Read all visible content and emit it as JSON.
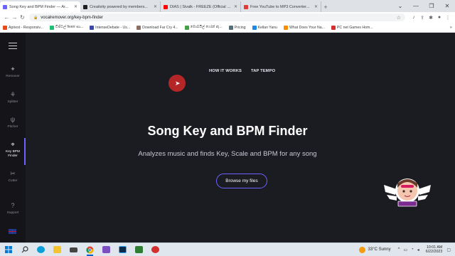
{
  "tabs": [
    {
      "title": "Song Key and BPM Finder — Ar...",
      "active": true,
      "icon": "vocalremover-favicon",
      "color": "#6c63ff"
    },
    {
      "title": "Creativity powered by members...",
      "active": false,
      "icon": "patreon-favicon",
      "color": "#1f1f1f"
    },
    {
      "title": "DIAS | Sivalk - FREEZE (Official Mu...",
      "active": false,
      "icon": "youtube-favicon",
      "color": "#ff0000"
    },
    {
      "title": "Free YouTube to MP3 Converter...",
      "active": false,
      "icon": "converter-favicon",
      "color": "#e53935"
    }
  ],
  "address": {
    "url": "vocalremover.org/key-bpm-finder"
  },
  "bookmarks": [
    {
      "label": "Apriest - Responsiv...",
      "color": "#e64a19"
    },
    {
      "label": "ඩිජිටල් fiverr සා...",
      "color": "#1dbf73"
    },
    {
      "label": "IntenseDebate - Us...",
      "color": "#3949ab"
    },
    {
      "label": "Download Far Cry 4...",
      "color": "#8d6e63"
    },
    {
      "label": "මොබයිල් ෆෝන් ඇ...",
      "color": "#43a047"
    },
    {
      "label": "Pricing",
      "color": "#546e7a"
    },
    {
      "label": "Kellan Yanu",
      "color": "#1e88e5"
    },
    {
      "label": "What Does Your Na...",
      "color": "#fb8c00"
    },
    {
      "label": "PC net Games Hom...",
      "color": "#d32f2f"
    }
  ],
  "sidebar": {
    "items": [
      {
        "label": "Remover",
        "icon": "sparkle-icon",
        "glyph": "✦",
        "active": false
      },
      {
        "label": "Splitter",
        "icon": "splitter-icon",
        "glyph": "⚘",
        "active": false
      },
      {
        "label": "Pitcher",
        "icon": "tuning-fork-icon",
        "glyph": "ψ",
        "active": false
      },
      {
        "label": "Key BPM Finder",
        "icon": "metronome-icon",
        "glyph": "⌖",
        "active": true
      },
      {
        "label": "Cutter",
        "icon": "scissors-icon",
        "glyph": "✂",
        "active": false
      },
      {
        "label": "Support",
        "icon": "help-icon",
        "glyph": "?",
        "active": false
      }
    ]
  },
  "topnav": {
    "how_it_works": "HOW IT WORKS",
    "tap_tempo": "TAP TEMPO"
  },
  "hero": {
    "title": "Song Key and BPM Finder",
    "subtitle": "Analyzes music and finds Key, Scale and BPM for any song",
    "browse_label": "Browse my files"
  },
  "taskbar": {
    "apps": [
      {
        "icon": "windows-start-icon",
        "color": "#0078d4"
      },
      {
        "icon": "search-icon",
        "color": "#333333"
      },
      {
        "icon": "edge-icon",
        "color": "#0c9ed9"
      },
      {
        "icon": "file-explorer-icon",
        "color": "#f4c430"
      },
      {
        "icon": "mail-icon",
        "color": "#444444"
      },
      {
        "icon": "chrome-icon",
        "color": "#34a853",
        "running": true
      },
      {
        "icon": "visual-studio-icon",
        "color": "#7b4fbf"
      },
      {
        "icon": "photoshop-icon",
        "color": "#0b2a4a"
      },
      {
        "icon": "sound-recorder-icon",
        "color": "#2e7d32"
      },
      {
        "icon": "record-icon",
        "color": "#d32f2f"
      }
    ],
    "weather": "33°C  Sunny",
    "time": "10:01 AM",
    "date": "6/22/2023"
  },
  "colors": {
    "accent": "#6c63ff",
    "background": "#1b1b22",
    "sidebar": "#141419"
  }
}
